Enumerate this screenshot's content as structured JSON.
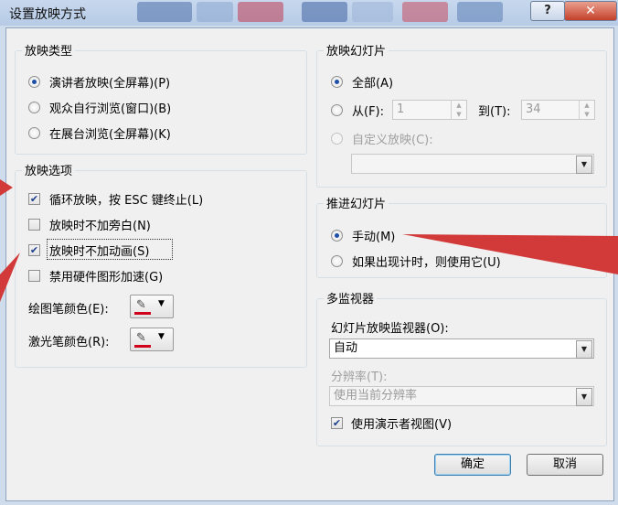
{
  "window": {
    "title": "设置放映方式",
    "help_glyph": "?",
    "close_glyph": "✕"
  },
  "show_type": {
    "legend": "放映类型",
    "options": [
      {
        "label": "演讲者放映(全屏幕)(P)",
        "selected": true
      },
      {
        "label": "观众自行浏览(窗口)(B)",
        "selected": false
      },
      {
        "label": "在展台浏览(全屏幕)(K)",
        "selected": false
      }
    ]
  },
  "show_options": {
    "legend": "放映选项",
    "checks": [
      {
        "label": "循环放映，按 ESC 键终止(L)",
        "checked": true
      },
      {
        "label": "放映时不加旁白(N)",
        "checked": false
      },
      {
        "label": "放映时不加动画(S)",
        "checked": true
      },
      {
        "label": "禁用硬件图形加速(G)",
        "checked": false
      }
    ],
    "pen_color_label": "绘图笔颜色(E):",
    "laser_color_label": "激光笔颜色(R):",
    "pen_color": "#d0021b",
    "laser_color": "#d0021b"
  },
  "show_slides": {
    "legend": "放映幻灯片",
    "all_label": "全部(A)",
    "from_label": "从(F):",
    "from_value": "1",
    "to_label": "到(T):",
    "to_value": "34",
    "custom_label": "自定义放映(C):",
    "custom_value": ""
  },
  "advance": {
    "legend": "推进幻灯片",
    "manual_label": "手动(M)",
    "timing_label": "如果出现计时，则使用它(U)"
  },
  "monitors": {
    "legend": "多监视器",
    "monitor_label": "幻灯片放映监视器(O):",
    "monitor_value": "自动",
    "resolution_label": "分辨率(T):",
    "resolution_value": "使用当前分辨率",
    "presenter_label": "使用演示者视图(V)",
    "presenter_checked": true
  },
  "buttons": {
    "ok": "确定",
    "cancel": "取消"
  },
  "colors": {
    "annotation_arrow": "#d23a3a",
    "accent": "#1d4fa8"
  },
  "icons": {
    "check": "✔",
    "dropdown": "▼",
    "spin_up": "▲",
    "spin_down": "▼",
    "pen": "✎"
  }
}
